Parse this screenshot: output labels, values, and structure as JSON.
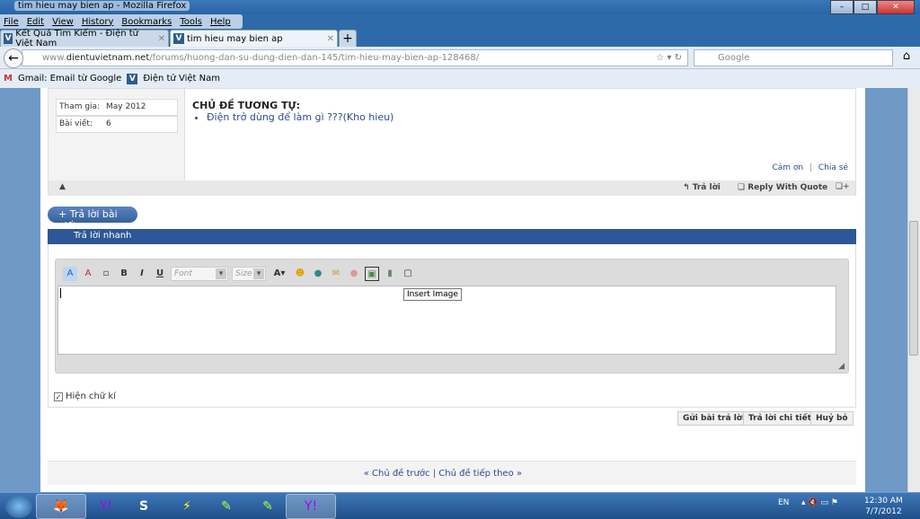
{
  "window": {
    "title": "tim hieu may bien ap - Mozilla Firefox",
    "min": "–",
    "max": "□",
    "close": "✕"
  },
  "menu": [
    "File",
    "Edit",
    "View",
    "History",
    "Bookmarks",
    "Tools",
    "Help"
  ],
  "tabs": [
    {
      "label": "Kết Quả Tìm Kiếm - Điện tử Việt Nam"
    },
    {
      "label": "tim hieu may bien ap"
    }
  ],
  "new_tab": "+",
  "url": {
    "prefix": "www.",
    "domain": "dientuvietnam.net",
    "path": "/forums/huong-dan-su-dung-dien-dan-145/tim-hieu-may-bien-ap-128468/"
  },
  "search": {
    "placeholder": "Google"
  },
  "bookmarks": [
    "Gmail: Email từ Google",
    "Điện tử Việt Nam"
  ],
  "post": {
    "user_info": [
      {
        "label": "Tham gia:",
        "value": "May 2012"
      },
      {
        "label": "Bài viết:",
        "value": "6"
      }
    ],
    "related_title": "CHỦ ĐỀ TƯƠNG TỰ:",
    "related": [
      "Điện trở dùng để làm gì ???(Kho hieu)"
    ],
    "thanks": "Cảm ơn",
    "share": "Chia sẻ",
    "sep": "|",
    "reply": "Trả lời",
    "reply_quote": "Reply With Quote"
  },
  "reply_button": "+ Trả lời bài viết",
  "quick_reply": {
    "title": "Trả lời nhanh",
    "font": "Font",
    "size": "Size",
    "tooltip": "Insert Image",
    "signature": "Hiện chữ kí",
    "signature_checked": true
  },
  "actions": [
    "Gửi bài trả lời",
    "Trả lời chi tiết",
    "Huỷ bỏ"
  ],
  "thread_nav": {
    "prev": "« Chủ đề trước",
    "sep": "|",
    "next": "Chủ đề tiếp theo »"
  },
  "tray": {
    "lang": "EN",
    "time": "12:30 AM",
    "date": "7/7/2012"
  }
}
